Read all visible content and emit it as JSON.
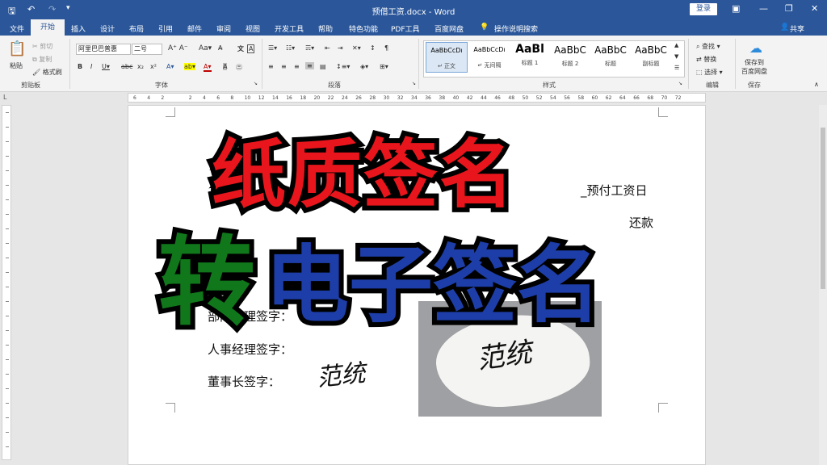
{
  "titlebar": {
    "doc_title": "预借工资.docx - Word",
    "login": "登录",
    "qa_icons": [
      "save-icon",
      "undo-icon",
      "redo-icon",
      "customize-icon"
    ]
  },
  "tabs": {
    "file": "文件",
    "home": "开始",
    "items": [
      "插入",
      "设计",
      "布局",
      "引用",
      "邮件",
      "审阅",
      "视图",
      "开发工具",
      "帮助",
      "特色功能",
      "PDF工具",
      "百度网盘"
    ],
    "tell_me": "操作说明搜索",
    "share": "共享"
  },
  "ribbon": {
    "clipboard": {
      "paste": "粘贴",
      "cut": "剪切",
      "copy": "复制",
      "format_painter": "格式刷",
      "label": "剪贴板"
    },
    "font": {
      "name": "阿里巴巴普惠",
      "size": "二号",
      "label": "字体"
    },
    "paragraph": {
      "label": "段落"
    },
    "styles": {
      "label": "样式",
      "items": [
        {
          "preview": "AaBbCcDı",
          "name": "↵ 正文"
        },
        {
          "preview": "AaBbCcDı",
          "name": "↵ 无间隔"
        },
        {
          "preview": "AaBl",
          "name": "标题 1"
        },
        {
          "preview": "AaBbC",
          "name": "标题 2"
        },
        {
          "preview": "AaBbC",
          "name": "标题"
        },
        {
          "preview": "AaBbC",
          "name": "副标题"
        }
      ]
    },
    "editing": {
      "find": "查找",
      "replace": "替换",
      "select": "选择",
      "label": "编辑"
    },
    "save": {
      "line1": "保存到",
      "line2": "百度网盘",
      "label": "保存"
    }
  },
  "ruler_numbers": [
    "6",
    "4",
    "2",
    "",
    "2",
    "4",
    "6",
    "8",
    "10",
    "12",
    "14",
    "16",
    "18",
    "20",
    "22",
    "24",
    "26",
    "28",
    "30",
    "32",
    "34",
    "36",
    "38",
    "40",
    "42",
    "44",
    "46",
    "48",
    "50",
    "52",
    "54",
    "56",
    "58",
    "60",
    "62",
    "64",
    "66",
    "68",
    "70",
    "72"
  ],
  "document": {
    "line1_tail": "_预付工资日",
    "line2_tail": "还款",
    "sign_dept": "部门经理签字：",
    "sign_hr": "人事经理签字：",
    "sign_chair": "董事长签字：",
    "signature": "范统"
  },
  "overlay": {
    "line1": "纸质签名",
    "zhuan": "转",
    "line2": "电子签名"
  },
  "colors": {
    "word_blue": "#2b579a",
    "title_red": "#e8161c",
    "title_green": "#10781b",
    "title_blue": "#1d3ea8"
  }
}
